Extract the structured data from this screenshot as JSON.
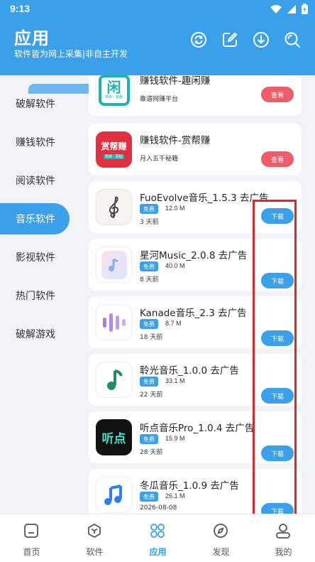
{
  "status_bar": {
    "time": "9:13"
  },
  "header": {
    "title": "应用",
    "subtitle": "软件皆为网上采集|非自主开发"
  },
  "categories": [
    {
      "label": "破解软件"
    },
    {
      "label": "赚钱软件"
    },
    {
      "label": "阅读软件"
    },
    {
      "label": "音乐软件",
      "active": true
    },
    {
      "label": "影视软件"
    },
    {
      "label": "热门软件"
    },
    {
      "label": "破解游戏"
    }
  ],
  "apps": [
    {
      "name": "赚钱软件-趣闲赚",
      "desc": "靠谱网赚平台",
      "button": "查看",
      "icon": "quxianzhuan-icon",
      "icon_text": "闲",
      "icon_sub": "简单 · 有趣"
    },
    {
      "name": "赚钱软件-赏帮赚",
      "desc": "月入五千秘籍",
      "button": "查看",
      "icon": "shangbangzhuan-icon",
      "icon_text": "赏帮赚",
      "icon_sub": "简单 · 即提"
    },
    {
      "name": "FuoEvolve音乐_1.5.3 去广告",
      "badge": "免费",
      "size": "12.0 M",
      "date": "3 天前",
      "button": "下载",
      "icon": "treble-clef-icon"
    },
    {
      "name": "星河Music_2.0.8 去广告",
      "badge": "免费",
      "size": "40.0 M",
      "date": "8 天前",
      "button": "下载",
      "icon": "music-note-tile-icon"
    },
    {
      "name": "Kanade音乐_2.3 去广告",
      "badge": "免费",
      "size": "8.7 M",
      "date": "18 天前",
      "button": "下载",
      "icon": "sound-wave-icon"
    },
    {
      "name": "聆光音乐_1.0.0 去广告",
      "badge": "免费",
      "size": "33.1 M",
      "date": "22 天前",
      "button": "下载",
      "icon": "green-note-icon"
    },
    {
      "name": "听点音乐Pro_1.0.4 去广告",
      "badge": "免费",
      "size": "15.9 M",
      "date": "28 天前",
      "button": "下载",
      "icon": "tingdian-icon",
      "icon_text": "听点"
    },
    {
      "name": "冬瓜音乐_1.0.9 去广告",
      "badge": "免费",
      "size": "26.1 M",
      "date": "2026-08-08",
      "button": "下载",
      "icon": "blue-notes-icon"
    }
  ],
  "bottom_nav": [
    {
      "label": "首页",
      "icon": "home-icon"
    },
    {
      "label": "软件",
      "icon": "cube-icon"
    },
    {
      "label": "应用",
      "icon": "apps-icon",
      "active": true
    },
    {
      "label": "发现",
      "icon": "compass-icon"
    },
    {
      "label": "我的",
      "icon": "user-icon"
    }
  ],
  "colors": {
    "primary": "#3aa0ea",
    "view_button": "#ee5b6b",
    "highlight": "#e0262a"
  }
}
